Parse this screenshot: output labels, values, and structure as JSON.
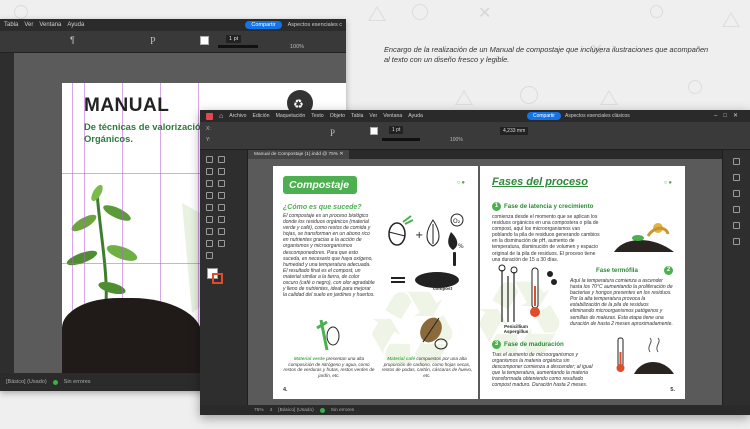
{
  "caption": "Encargo de la realización de un Manual de compostaje que incluyera ilustraciones que acompañen al texto con un diseño fresco y legible.",
  "back_window": {
    "menu": [
      "Tabla",
      "Ver",
      "Ventana",
      "Ayuda"
    ],
    "share_label": "Compartir",
    "workspace_label": "Aspectos esenciales c",
    "stroke_value": "1 pt",
    "zoom": "100%",
    "page_title": "MANUAL",
    "page_subtitle": "De técnicas de valorización de Residuos Orgánicos.",
    "status_text": "[Básico] (Usado)",
    "errors_text": "Sin errores"
  },
  "front_window": {
    "menu": [
      "Archivo",
      "Edición",
      "Maquetación",
      "Texto",
      "Objeto",
      "Tabla",
      "Ver",
      "Ventana",
      "Ayuda"
    ],
    "share_label": "Compartir",
    "workspace_label": "Aspectos esenciales clásicos",
    "stroke_value": "1 pt",
    "zoom_field": "100%",
    "measure_field": "4,233 mm",
    "tab_label": "Manual de Compostaje (1).indd @ 75%",
    "status_zoom": "75%",
    "status_page": "4",
    "status_text": "[Básico] (Usado)",
    "errors_text": "Sin errores"
  },
  "left_page": {
    "title": "Compostaje",
    "section_title": "¿Cómo es que sucede?",
    "body": "El compostaje es un proceso biológico donde los residuos orgánicos (material verde y café), como restos de comida y hojas, se transforman en un abono rico en nutrientes gracias a la acción de organismos y microorganismos descomponedores. Para que esto suceda, es necesario que haya oxígeno, humedad y una temperatura adecuada. El resultado final es el compost, un material similar a la tierra, de color oscuro (café o negro), con olor agradable y lleno de nutrientes, ideal para mejorar la calidad del suelo en jardines y huertos.",
    "compost_label": "compost",
    "caption_green_bold": "Material verde",
    "caption_green": "presentan una alta composición de nitrógeno y agua, como restos de verduras y frutas, restos verdes de jardín, etc.",
    "caption_brown_bold": "Material café",
    "caption_brown": "compuestos por una alta proporción de carbono, como hojas secas, restos de podas, cartón, cáscaras de huevo, etc.",
    "page_number": "4."
  },
  "right_page": {
    "title": "Fases del proceso",
    "phase1_number": "1",
    "phase1_title": "Fase de latencia y crecimiento",
    "phase1_text": "comienza desde el momento que se aplican los residuos orgánicos en una compostera o pila de compost, aquí los microorganismos van poblando la pila de residuos generando cambios en la disminución de pH, aumento de temperatura, disminución de volumen y espacio original de la pila de residuos. El proceso tiene una duración de 15 a 30 días.",
    "phase2_number": "2",
    "phase2_title": "Fase termófila",
    "phase2_text": "Aquí la temperatura comienza a ascender hasta los 70°C aumentando la proliferación de bacterias y hongos presentes en los residuos. Por la alta temperatura provoca la estabilización de la pila de residuos eliminando microorganismos patógenos y semillas de malezas. Esta etapa tiene una duración de hasta 2 meses aproximadamente.",
    "fungus_label": "Penicillium Aspergillus",
    "phase3_number": "3",
    "phase3_title": "Fase de maduración",
    "phase3_text": "Tras el aumento de microorganismos y organismos la materia orgánica sin descomponer comienza a descender; al igual que la temperatura, aumentando la materia transformada obteniendo como resultado compost maduro. Duración hasta 2 meses.",
    "page_number": "5."
  },
  "colors": {
    "accent_green": "#4caf50",
    "dark_green": "#2f8a3a",
    "share_blue": "#1473e6"
  }
}
